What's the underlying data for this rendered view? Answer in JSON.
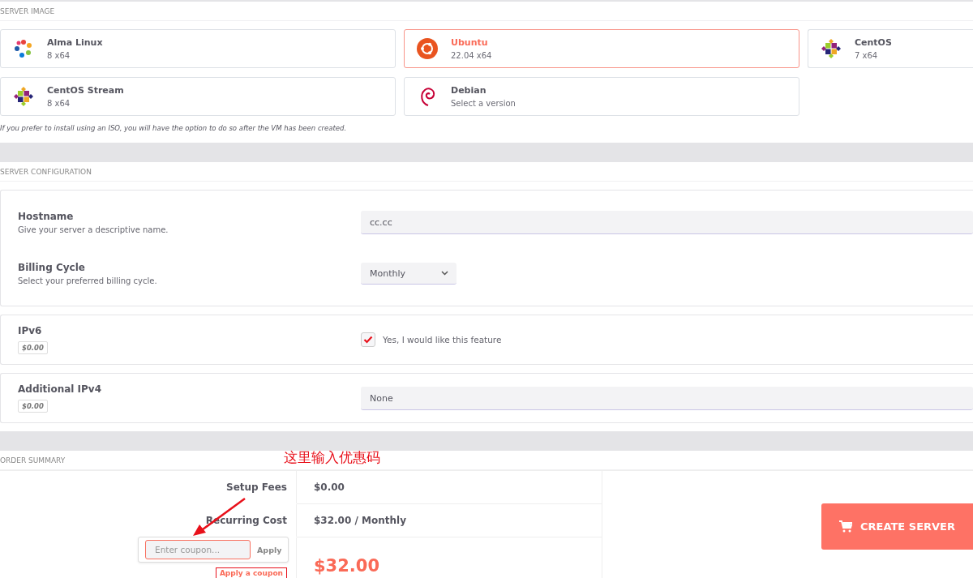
{
  "server_image": {
    "title": "SERVER IMAGE",
    "images": [
      {
        "name": "Alma Linux",
        "version": "8 x64",
        "kind": "alma",
        "selected": false
      },
      {
        "name": "Ubuntu",
        "version": "22.04 x64",
        "kind": "ubuntu",
        "selected": true
      },
      {
        "name": "CentOS",
        "version": "7 x64",
        "kind": "centos",
        "selected": false
      },
      {
        "name": "CentOS Stream",
        "version": "8 x64",
        "kind": "centos",
        "selected": false
      },
      {
        "name": "Debian",
        "version": "Select a version",
        "kind": "debian",
        "selected": false
      }
    ],
    "note": "If you prefer to install using an ISO, you will have the option to do so after the VM has been created."
  },
  "server_configuration": {
    "title": "SERVER CONFIGURATION",
    "cards": [
      {
        "fields": [
          {
            "label": "Hostname",
            "description": "Give your server a descriptive name.",
            "kind": "text",
            "value": "cc.cc"
          },
          {
            "label": "Billing Cycle",
            "description": "Select your preferred billing cycle.",
            "kind": "select",
            "value": "Monthly"
          }
        ]
      },
      {
        "fields": [
          {
            "label": "IPv6",
            "price": "$0.00",
            "kind": "checkbox",
            "checked": true,
            "option": "Yes, I would like this feature"
          }
        ]
      },
      {
        "fields": [
          {
            "label": "Additional IPv4",
            "price": "$0.00",
            "kind": "wideselect",
            "value": "None"
          }
        ]
      }
    ]
  },
  "order_summary": {
    "title": "ORDER SUMMARY",
    "rows": [
      {
        "label": "Setup Fees",
        "value": "$0.00"
      },
      {
        "label": "Recurring Cost",
        "value": "$32.00 / Monthly"
      }
    ],
    "total": "$32.00",
    "coupon": {
      "placeholder": "Enter coupon...",
      "button": "Apply",
      "link": "Apply a coupon"
    },
    "create_button": "CREATE SERVER"
  },
  "annotation": {
    "text": "这里输入优惠码"
  }
}
